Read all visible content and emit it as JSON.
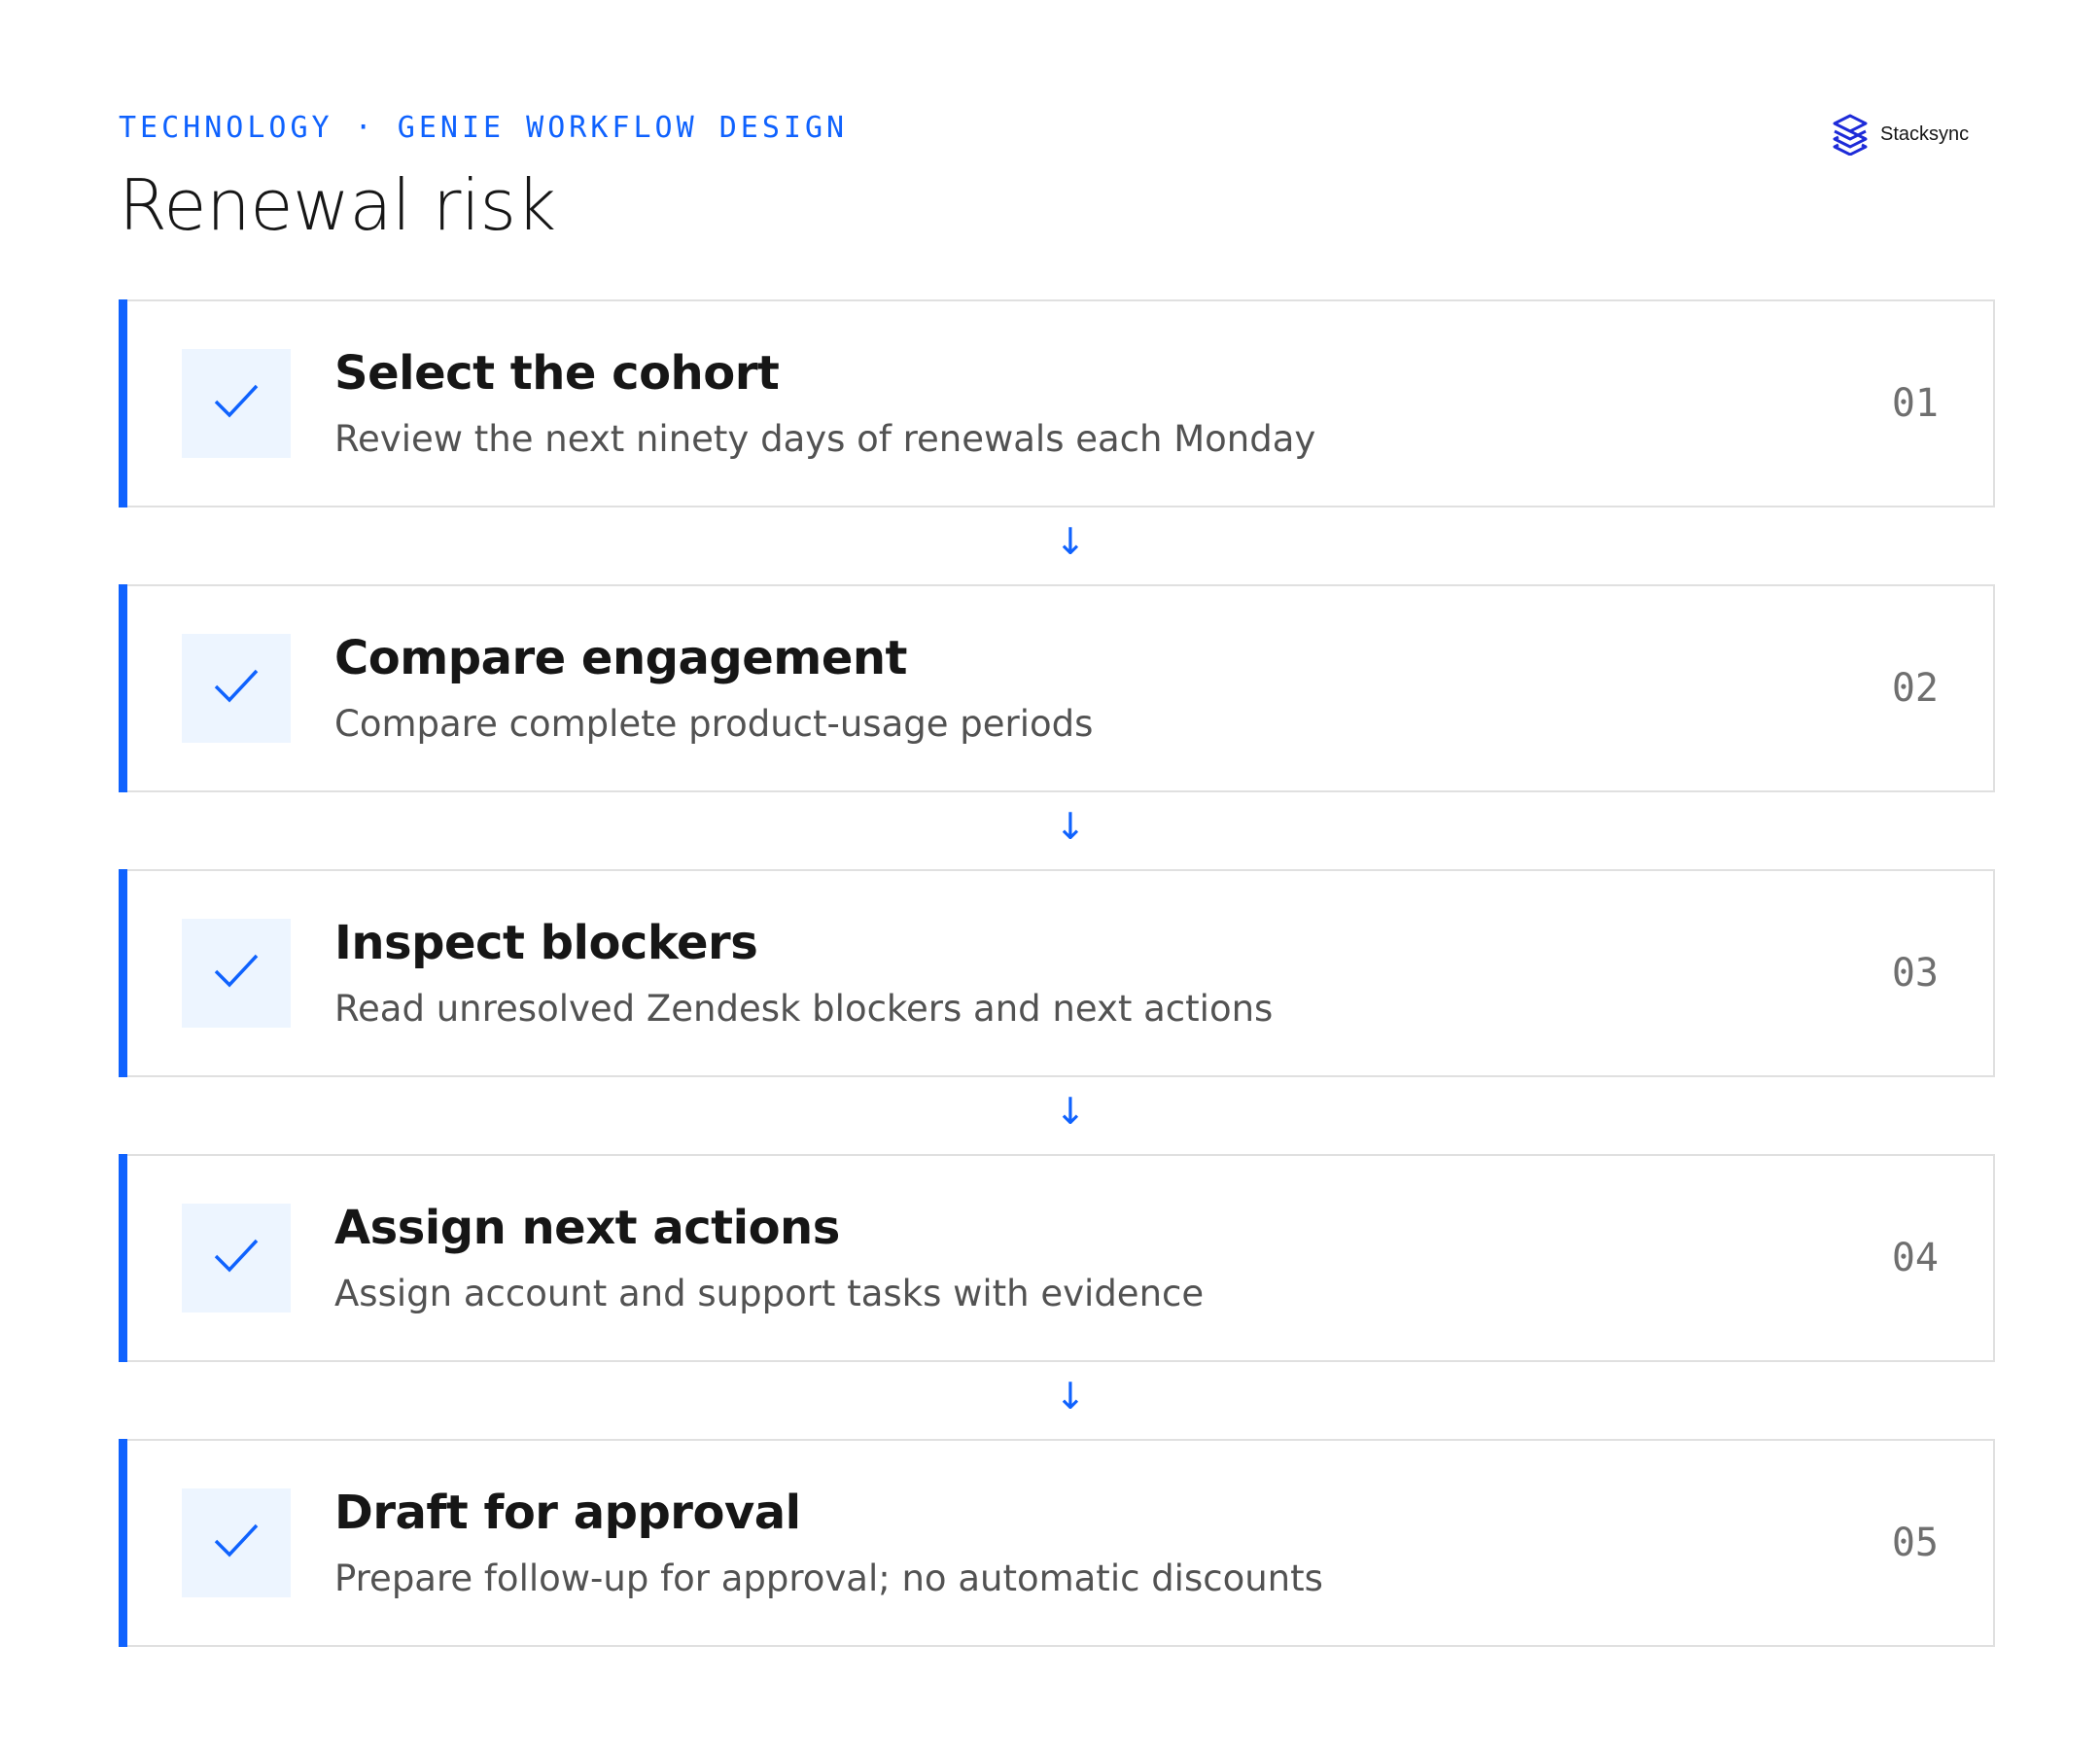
{
  "header": {
    "eyebrow": "TECHNOLOGY · GENIE WORKFLOW DESIGN",
    "title": "Renewal risk"
  },
  "logo": {
    "icon": "stacksync-logo-icon",
    "text": "Stacksync"
  },
  "colors": {
    "accent": "#0f62fe",
    "check_bg": "#edf5ff",
    "border": "#e0e0e0",
    "text_primary": "#161616",
    "text_secondary": "#525252",
    "number": "#6f6f6f"
  },
  "steps": [
    {
      "title": "Select the cohort",
      "description": "Review the next ninety days of renewals each Monday",
      "number": "01",
      "status_icon": "check-icon"
    },
    {
      "title": "Compare engagement",
      "description": "Compare complete product-usage periods",
      "number": "02",
      "status_icon": "check-icon"
    },
    {
      "title": "Inspect blockers",
      "description": "Read unresolved Zendesk blockers and next actions",
      "number": "03",
      "status_icon": "check-icon"
    },
    {
      "title": "Assign next actions",
      "description": "Assign account and support tasks with evidence",
      "number": "04",
      "status_icon": "check-icon"
    },
    {
      "title": "Draft for approval",
      "description": "Prepare follow-up for approval; no automatic discounts",
      "number": "05",
      "status_icon": "check-icon"
    }
  ],
  "connector_icon": "arrow-down-icon",
  "connector_glyph": "↓"
}
